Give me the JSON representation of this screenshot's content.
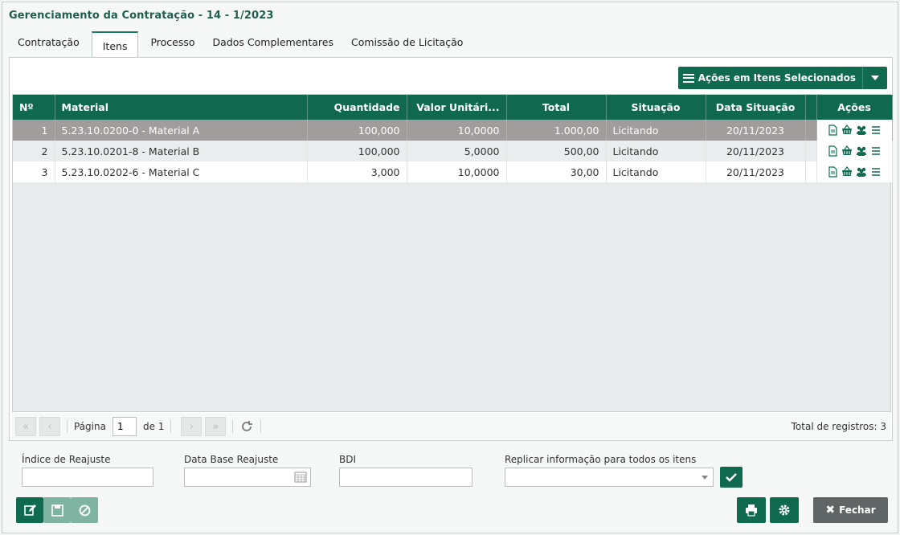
{
  "window": {
    "title": "Gerenciamento da Contratação - 14 - 1/2023"
  },
  "tabs": [
    {
      "label": "Contratação"
    },
    {
      "label": "Itens"
    },
    {
      "label": "Processo"
    },
    {
      "label": "Dados Complementares"
    },
    {
      "label": "Comissão de Licitação"
    }
  ],
  "toolbar": {
    "actions_label": "Ações em Itens Selecionados"
  },
  "table": {
    "columns": [
      "Nº",
      "Material",
      "Quantidade",
      "Valor Unitári...",
      "Total",
      "Situação",
      "Data Situação",
      "Ações"
    ],
    "rows": [
      {
        "n": "1",
        "material": "5.23.10.0200-0 - Material A",
        "quantidade": "100,000",
        "valor": "10,0000",
        "total": "1.000,00",
        "situacao": "Licitando",
        "data": "20/11/2023"
      },
      {
        "n": "2",
        "material": "5.23.10.0201-8 - Material B",
        "quantidade": "100,000",
        "valor": "5,0000",
        "total": "500,00",
        "situacao": "Licitando",
        "data": "20/11/2023"
      },
      {
        "n": "3",
        "material": "5.23.10.0202-6 - Material C",
        "quantidade": "3,000",
        "valor": "10,0000",
        "total": "30,00",
        "situacao": "Licitando",
        "data": "20/11/2023"
      }
    ]
  },
  "pager": {
    "page_label": "Página",
    "page_value": "1",
    "of_label": "de 1",
    "total_label": "Total de registros: 3"
  },
  "form": {
    "indice_label": "Índice de Reajuste",
    "data_base_label": "Data Base Reajuste",
    "bdi_label": "BDI",
    "replicar_label": "Replicar informação para todos os itens"
  },
  "footer": {
    "close_label": "Fechar"
  },
  "colors": {
    "primary": "#0f6a4f",
    "selected_row": "#a09d9c",
    "header": "#10694f"
  }
}
